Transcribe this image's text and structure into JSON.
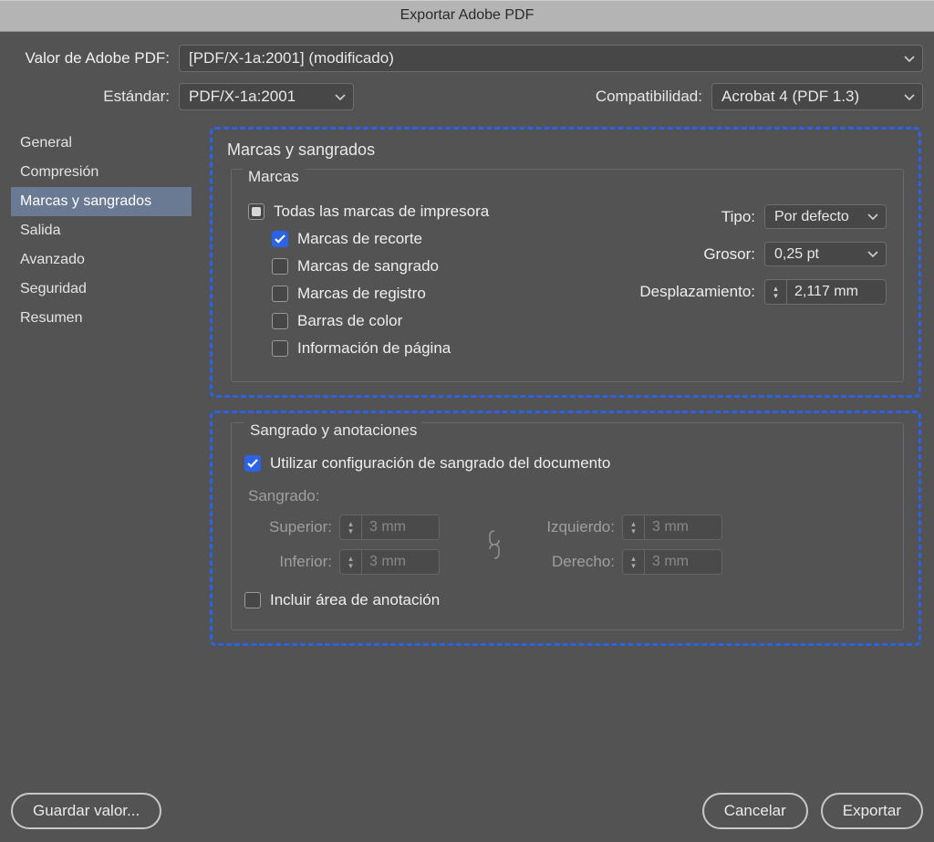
{
  "window": {
    "title": "Exportar Adobe PDF"
  },
  "preset": {
    "label": "Valor de Adobe PDF:",
    "value": "[PDF/X-1a:2001] (modificado)"
  },
  "standard": {
    "label": "Estándar:",
    "value": "PDF/X-1a:2001"
  },
  "compatibility": {
    "label": "Compatibilidad:",
    "value": "Acrobat 4 (PDF 1.3)"
  },
  "sidebar": {
    "items": [
      {
        "label": "General"
      },
      {
        "label": "Compresión"
      },
      {
        "label": "Marcas y sangrados"
      },
      {
        "label": "Salida"
      },
      {
        "label": "Avanzado"
      },
      {
        "label": "Seguridad"
      },
      {
        "label": "Resumen"
      }
    ],
    "selectedIndex": 2
  },
  "panel": {
    "title": "Marcas y sangrados",
    "marks": {
      "groupLabel": "Marcas",
      "all": "Todas las marcas de impresora",
      "crop": "Marcas de recorte",
      "bleed": "Marcas de sangrado",
      "registration": "Marcas de registro",
      "colorBars": "Barras de color",
      "pageInfo": "Información de página",
      "type": {
        "label": "Tipo:",
        "value": "Por defecto"
      },
      "weight": {
        "label": "Grosor:",
        "value": "0,25 pt"
      },
      "offset": {
        "label": "Desplazamiento:",
        "value": "2,117 mm"
      }
    },
    "bleedSlug": {
      "groupLabel": "Sangrado y anotaciones",
      "useDoc": "Utilizar configuración de sangrado del documento",
      "bleedLabel": "Sangrado:",
      "top": {
        "label": "Superior:",
        "value": "3 mm"
      },
      "bottom": {
        "label": "Inferior:",
        "value": "3 mm"
      },
      "left": {
        "label": "Izquierdo:",
        "value": "3 mm"
      },
      "right": {
        "label": "Derecho:",
        "value": "3 mm"
      },
      "includeSlug": "Incluir área de anotación"
    }
  },
  "footer": {
    "savePreset": "Guardar valor...",
    "cancel": "Cancelar",
    "export": "Exportar"
  }
}
